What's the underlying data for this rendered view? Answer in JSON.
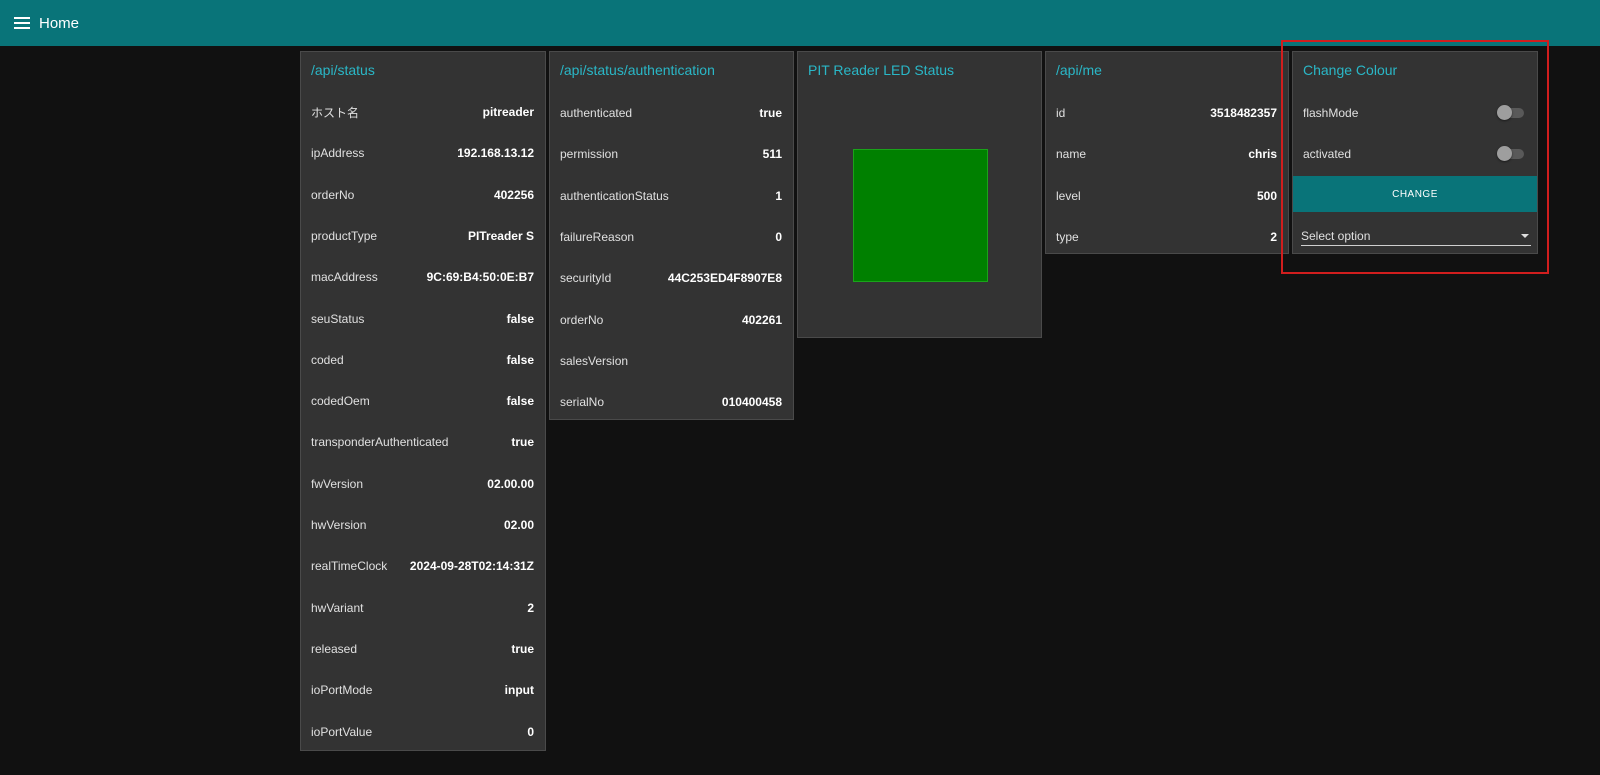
{
  "header": {
    "title": "Home",
    "menu_icon": "menu-icon"
  },
  "status_card": {
    "title": "/api/status",
    "rows": [
      {
        "key": "ホスト名",
        "value": "pitreader"
      },
      {
        "key": "ipAddress",
        "value": "192.168.13.12"
      },
      {
        "key": "orderNo",
        "value": "402256"
      },
      {
        "key": "productType",
        "value": "PITreader S"
      },
      {
        "key": "macAddress",
        "value": "9C:69:B4:50:0E:B7"
      },
      {
        "key": "seuStatus",
        "value": "false"
      },
      {
        "key": "coded",
        "value": "false"
      },
      {
        "key": "codedOem",
        "value": "false"
      },
      {
        "key": "transponderAuthenticated",
        "value": "true"
      },
      {
        "key": "fwVersion",
        "value": "02.00.00"
      },
      {
        "key": "hwVersion",
        "value": "02.00"
      },
      {
        "key": "realTimeClock",
        "value": "2024-09-28T02:14:31Z"
      },
      {
        "key": "hwVariant",
        "value": "2"
      },
      {
        "key": "released",
        "value": "true"
      },
      {
        "key": "ioPortMode",
        "value": "input"
      },
      {
        "key": "ioPortValue",
        "value": "0"
      }
    ]
  },
  "auth_card": {
    "title": "/api/status/authentication",
    "rows": [
      {
        "key": "authenticated",
        "value": "true"
      },
      {
        "key": "permission",
        "value": "511"
      },
      {
        "key": "authenticationStatus",
        "value": "1"
      },
      {
        "key": "failureReason",
        "value": "0"
      },
      {
        "key": "securityId",
        "value": "44C253ED4F8907E8"
      },
      {
        "key": "orderNo",
        "value": "402261"
      },
      {
        "key": "salesVersion",
        "value": ""
      },
      {
        "key": "serialNo",
        "value": "010400458"
      }
    ]
  },
  "led_card": {
    "title": "PIT Reader LED Status",
    "led_color": "#008000"
  },
  "me_card": {
    "title": "/api/me",
    "rows": [
      {
        "key": "id",
        "value": "3518482357"
      },
      {
        "key": "name",
        "value": "chris"
      },
      {
        "key": "level",
        "value": "500"
      },
      {
        "key": "type",
        "value": "2"
      }
    ]
  },
  "colour_card": {
    "title": "Change Colour",
    "flash_mode_label": "flashMode",
    "flash_mode_on": false,
    "activated_label": "activated",
    "activated_on": false,
    "change_button_label": "CHANGE",
    "select_value": "Select option"
  },
  "colors": {
    "topbar": "#097479",
    "accent_text": "#2ab7c7",
    "card_bg": "#333333",
    "page_bg": "#111111",
    "highlight": "#d11e1e"
  }
}
